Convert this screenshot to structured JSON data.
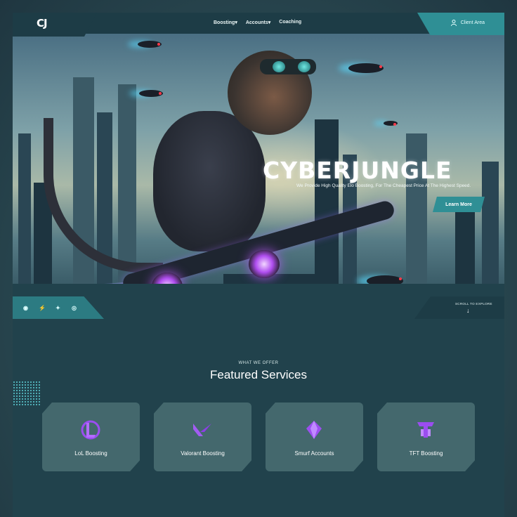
{
  "header": {
    "logo": "CJ",
    "nav": [
      "Boosting",
      "Accounts",
      "Coaching"
    ],
    "client_area": "Client Area"
  },
  "hero": {
    "title": "CYBERJUNGLE",
    "subtitle": "We Provide High Quality Elo Boosting, For The Cheapest Price At The Highest Speed.",
    "cta": "Learn More",
    "scroll_label": "SCROLL TO EXPLORE"
  },
  "socials": [
    "discord-icon",
    "bolt-icon",
    "twitter-icon",
    "instagram-icon"
  ],
  "services": {
    "eyebrow": "WHAT WE OFFER",
    "title": "Featured Services",
    "items": [
      {
        "label": "LoL Boosting",
        "icon": "league-icon"
      },
      {
        "label": "Valorant Boosting",
        "icon": "valorant-icon"
      },
      {
        "label": "Smurf Accounts",
        "icon": "diamond-icon"
      },
      {
        "label": "TFT Boosting",
        "icon": "tft-icon"
      }
    ]
  },
  "colors": {
    "accent": "#2f8f95",
    "icon_purple": "#9b4df0",
    "background": "#21424c"
  }
}
